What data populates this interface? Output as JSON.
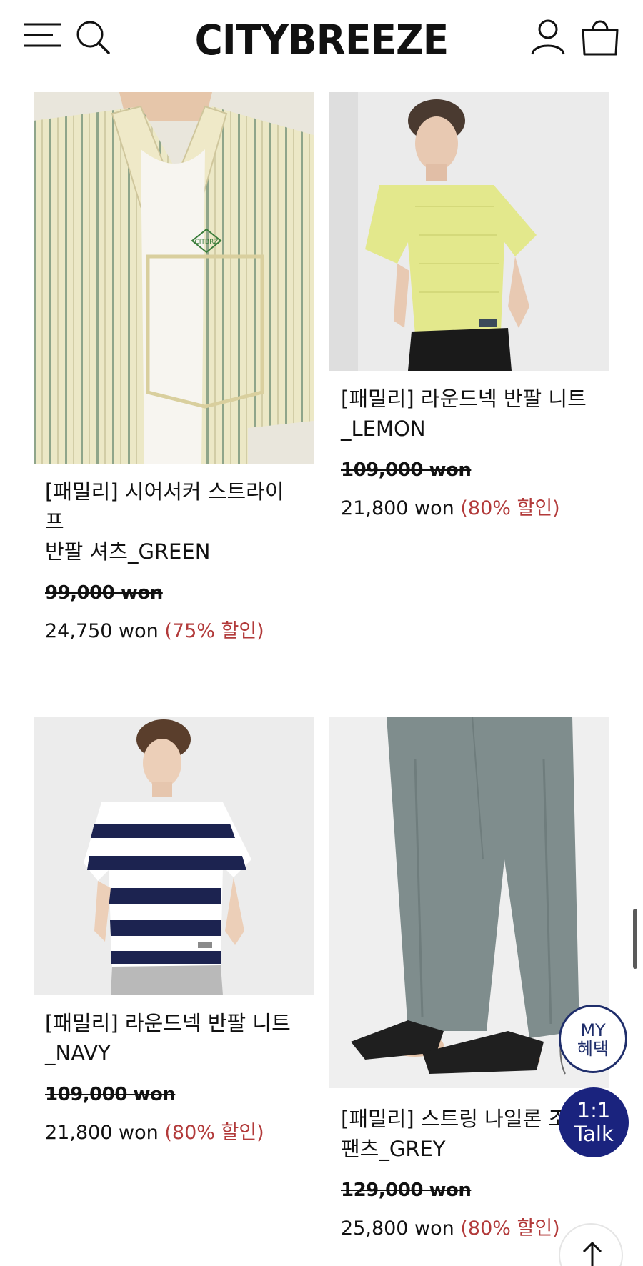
{
  "header": {
    "logo": "CITYBREEZE",
    "icons": [
      "menu-icon",
      "search-icon",
      "user-icon",
      "shopping-bag-icon"
    ]
  },
  "products": [
    {
      "name_line1": "[패밀리] 시어서커 스트라이프",
      "name_line2": "반팔 셔츠_GREEN",
      "original_price": "99,000 won",
      "sale_price": "24,750 won",
      "discount": "(75% 할인)",
      "shirt_logo": "CITBRZ"
    },
    {
      "name_line1": "[패밀리] 라운드넥 반팔 니트",
      "name_line2": "_LEMON",
      "original_price": "109,000 won",
      "sale_price": "21,800 won",
      "discount": "(80% 할인)"
    },
    {
      "name_line1": "[패밀리] 라운드넥 반팔 니트",
      "name_line2": "_NAVY",
      "original_price": "109,000 won",
      "sale_price": "21,800 won",
      "discount": "(80% 할인)"
    },
    {
      "name_line1": "[패밀리] 스트링 나일론 조",
      "name_line2": "팬츠_GREY",
      "original_price": "129,000 won",
      "sale_price": "25,800 won",
      "discount": "(80% 할인)"
    }
  ],
  "floating": {
    "my_line1": "MY",
    "my_line2": "혜택",
    "talk_line1": "1:1",
    "talk_line2": "Talk"
  },
  "colors": {
    "discount": "#b23a3a",
    "talk_button": "#1a237e",
    "my_button_border": "#1f2e6b"
  }
}
